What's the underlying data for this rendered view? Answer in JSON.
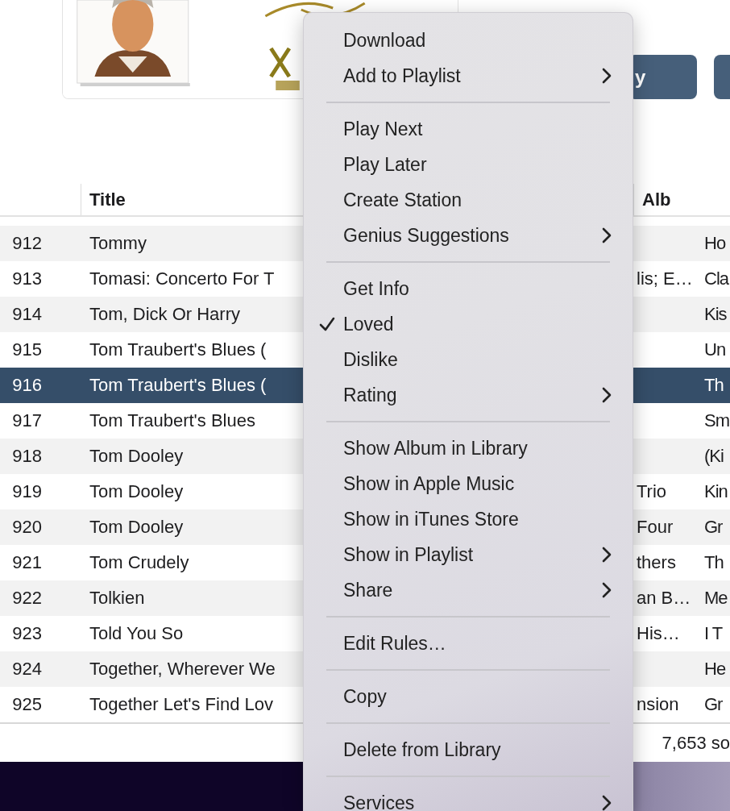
{
  "header": {
    "buttons": [
      {
        "label": "y"
      }
    ]
  },
  "table": {
    "columns": [
      {},
      {
        "label": "Title"
      },
      {},
      {
        "label": "Alb"
      }
    ],
    "rows": [
      {
        "number": "912",
        "title": "Tommy",
        "column_4": "Ho",
        "selected": false
      },
      {
        "number": "913",
        "title": "Tomasi: Concerto For T",
        "column_3": "lis; E…",
        "column_4": "Cla",
        "selected": false
      },
      {
        "number": "914",
        "title": "Tom, Dick Or Harry",
        "column_4": "Kis",
        "selected": false
      },
      {
        "number": "915",
        "title": "Tom Traubert's Blues (",
        "column_4": "Un",
        "selected": false
      },
      {
        "number": "916",
        "title": "Tom Traubert's Blues (",
        "column_4": "Th",
        "selected": true
      },
      {
        "number": "917",
        "title": "Tom Traubert's Blues",
        "column_4": "Sm",
        "selected": false
      },
      {
        "number": "918",
        "title": "Tom Dooley",
        "column_4": "(Ki",
        "selected": false
      },
      {
        "number": "919",
        "title": "Tom Dooley",
        "column_3": "Trio",
        "column_4": "Kin",
        "selected": false
      },
      {
        "number": "920",
        "title": "Tom Dooley",
        "column_3": "Four",
        "column_4": "Gr",
        "selected": false
      },
      {
        "number": "921",
        "title": "Tom Crudely",
        "column_3": "thers",
        "column_4": "Th",
        "selected": false
      },
      {
        "number": "922",
        "title": "Tolkien",
        "column_3": "an B…",
        "column_4": "Me",
        "selected": false
      },
      {
        "number": "923",
        "title": "Told You So",
        "column_3": "His…",
        "column_4": "I T",
        "selected": false
      },
      {
        "number": "924",
        "title": "Together, Wherever We",
        "column_4": "He",
        "selected": false
      },
      {
        "number": "925",
        "title": "Together Let's Find Lov",
        "column_3": "nsion",
        "column_4": "Gr",
        "selected": false
      }
    ]
  },
  "status_bar": {
    "text": "7,653 so"
  },
  "context_menu": {
    "sections": [
      [
        {
          "label": "Download",
          "submenu": false,
          "checked": false
        },
        {
          "label": "Add to Playlist",
          "submenu": true,
          "checked": false
        }
      ],
      [
        {
          "label": "Play Next",
          "submenu": false,
          "checked": false
        },
        {
          "label": "Play Later",
          "submenu": false,
          "checked": false
        },
        {
          "label": "Create Station",
          "submenu": false,
          "checked": false
        },
        {
          "label": "Genius Suggestions",
          "submenu": true,
          "checked": false
        }
      ],
      [
        {
          "label": "Get Info",
          "submenu": false,
          "checked": false
        },
        {
          "label": "Loved",
          "submenu": false,
          "checked": true
        },
        {
          "label": "Dislike",
          "submenu": false,
          "checked": false
        },
        {
          "label": "Rating",
          "submenu": true,
          "checked": false
        }
      ],
      [
        {
          "label": "Show Album in Library",
          "submenu": false,
          "checked": false
        },
        {
          "label": "Show in Apple Music",
          "submenu": false,
          "checked": false
        },
        {
          "label": "Show in iTunes Store",
          "submenu": false,
          "checked": false
        },
        {
          "label": "Show in Playlist",
          "submenu": true,
          "checked": false
        },
        {
          "label": "Share",
          "submenu": true,
          "checked": false
        }
      ],
      [
        {
          "label": "Edit Rules…",
          "submenu": false,
          "checked": false
        }
      ],
      [
        {
          "label": "Copy",
          "submenu": false,
          "checked": false
        }
      ],
      [
        {
          "label": "Delete from Library",
          "submenu": false,
          "checked": false
        }
      ],
      [
        {
          "label": "Services",
          "submenu": true,
          "checked": false
        }
      ]
    ]
  }
}
